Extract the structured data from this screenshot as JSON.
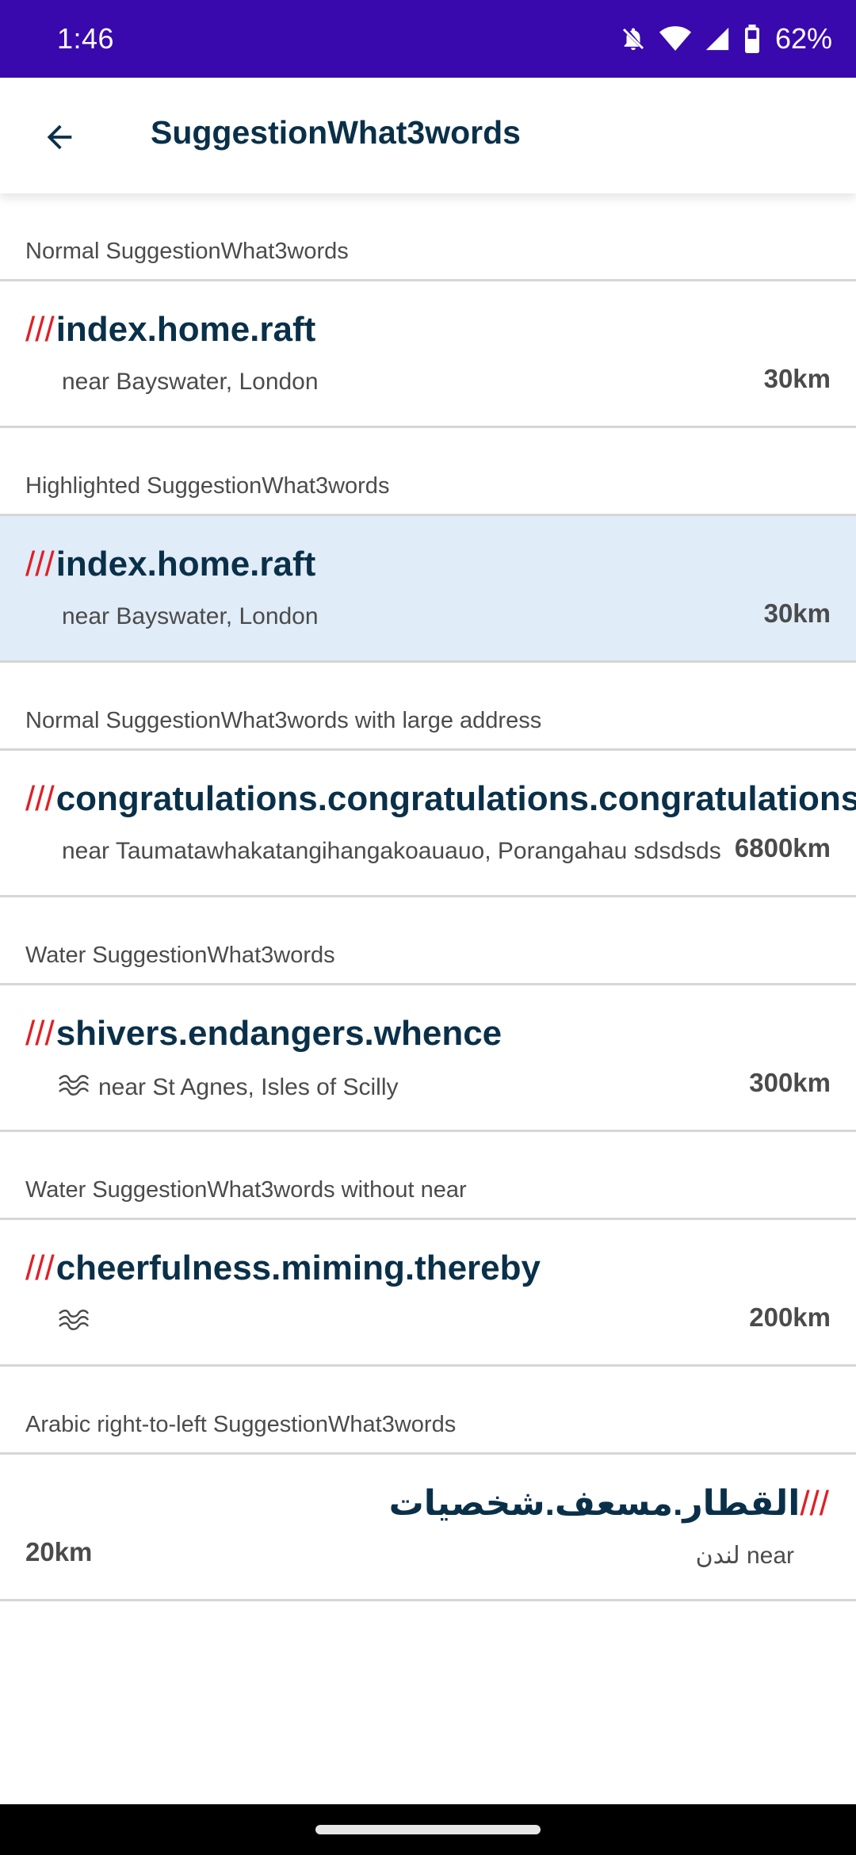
{
  "status_bar": {
    "time": "1:46",
    "battery": "62%",
    "icons": [
      "notifications-off-icon",
      "wifi-icon",
      "cell-signal-icon",
      "battery-icon"
    ],
    "bg_color": "#3909ad"
  },
  "app_bar": {
    "title": "SuggestionWhat3words",
    "back_icon": "arrow-back-icon"
  },
  "slashes": "///",
  "accent_color": "#e11f26",
  "highlight_color": "#e0ecf8",
  "sections": [
    {
      "header": "Normal SuggestionWhat3words",
      "words": "index.home.raft",
      "near": "near Bayswater, London",
      "distance": "30km"
    },
    {
      "header": "Highlighted SuggestionWhat3words",
      "words": "index.home.raft",
      "near": "near Bayswater, London",
      "distance": "30km"
    },
    {
      "header": "Normal SuggestionWhat3words with large address",
      "words": "congratulations.congratulations.congratulations",
      "near": "near Taumatawhakatangihangakoauauo, Porangahau sdsdsds",
      "distance": "6800km"
    },
    {
      "header": "Water SuggestionWhat3words",
      "words": "shivers.endangers.whence",
      "near": "near St Agnes, Isles of Scilly",
      "distance": "300km"
    },
    {
      "header": "Water SuggestionWhat3words without near",
      "words": "cheerfulness.miming.thereby",
      "near": "",
      "distance": "200km"
    },
    {
      "header": "Arabic right-to-left SuggestionWhat3words",
      "words": "القطار.مسعف.شخصيات",
      "near": "near لندن",
      "distance": "20km"
    }
  ]
}
